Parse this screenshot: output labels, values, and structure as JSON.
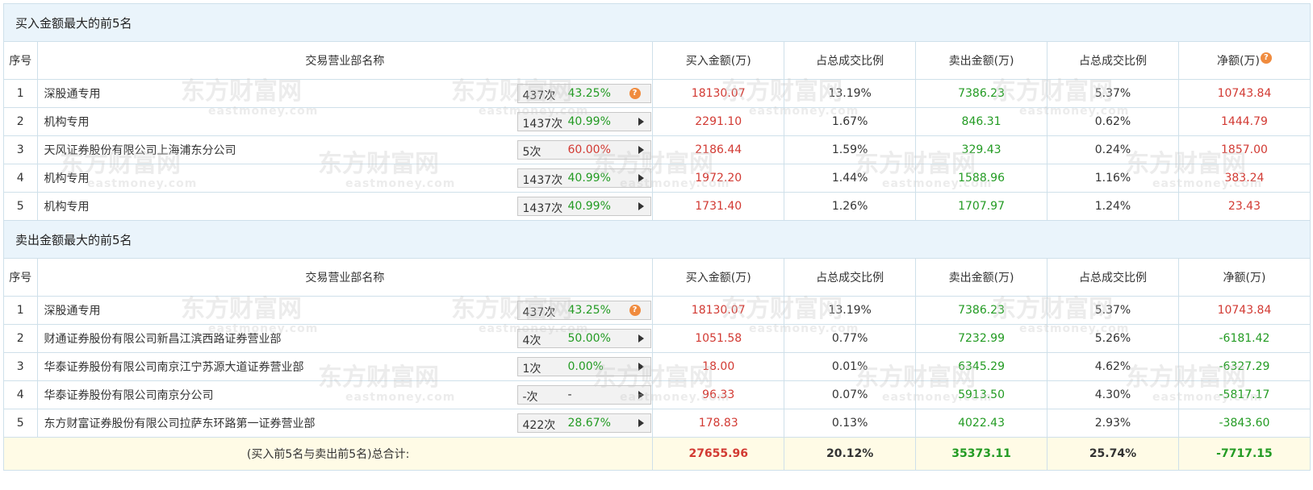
{
  "colors": {
    "red": "#d23a33",
    "green": "#239b23",
    "section_bg": "#eaf4fb",
    "total_bg": "#fffbe6"
  },
  "watermark": {
    "cn": "东方财富网",
    "en": "eastmoney.com"
  },
  "buy_section": {
    "title": "买入金额最大的前5名",
    "headers": [
      "序号",
      "交易营业部名称",
      "买入金额(万)",
      "占总成交比例",
      "卖出金额(万)",
      "占总成交比例",
      "净额(万)"
    ],
    "rows": [
      {
        "idx": "1",
        "name": "深股通专用",
        "count": "437次",
        "pct": "43.25%",
        "pct_color": "green",
        "icon": "question-icon",
        "buy": "18130.07",
        "buy_ratio": "13.19%",
        "sell": "7386.23",
        "sell_ratio": "5.37%",
        "net": "10743.84"
      },
      {
        "idx": "2",
        "name": "机构专用",
        "count": "1437次",
        "pct": "40.99%",
        "pct_color": "green",
        "icon": "arrow-right-icon",
        "buy": "2291.10",
        "buy_ratio": "1.67%",
        "sell": "846.31",
        "sell_ratio": "0.62%",
        "net": "1444.79"
      },
      {
        "idx": "3",
        "name": "天风证券股份有限公司上海浦东分公司",
        "count": "5次",
        "pct": "60.00%",
        "pct_color": "red",
        "icon": "arrow-right-icon",
        "buy": "2186.44",
        "buy_ratio": "1.59%",
        "sell": "329.43",
        "sell_ratio": "0.24%",
        "net": "1857.00"
      },
      {
        "idx": "4",
        "name": "机构专用",
        "count": "1437次",
        "pct": "40.99%",
        "pct_color": "green",
        "icon": "arrow-right-icon",
        "buy": "1972.20",
        "buy_ratio": "1.44%",
        "sell": "1588.96",
        "sell_ratio": "1.16%",
        "net": "383.24"
      },
      {
        "idx": "5",
        "name": "机构专用",
        "count": "1437次",
        "pct": "40.99%",
        "pct_color": "green",
        "icon": "arrow-right-icon",
        "buy": "1731.40",
        "buy_ratio": "1.26%",
        "sell": "1707.97",
        "sell_ratio": "1.24%",
        "net": "23.43"
      }
    ]
  },
  "sell_section": {
    "title": "卖出金额最大的前5名",
    "headers": [
      "序号",
      "交易营业部名称",
      "买入金额(万)",
      "占总成交比例",
      "卖出金额(万)",
      "占总成交比例",
      "净额(万)"
    ],
    "rows": [
      {
        "idx": "1",
        "name": "深股通专用",
        "count": "437次",
        "pct": "43.25%",
        "pct_color": "green",
        "icon": "question-icon",
        "buy": "18130.07",
        "buy_ratio": "13.19%",
        "sell": "7386.23",
        "sell_ratio": "5.37%",
        "net": "10743.84"
      },
      {
        "idx": "2",
        "name": "财通证券股份有限公司新昌江滨西路证券营业部",
        "count": "4次",
        "pct": "50.00%",
        "pct_color": "green",
        "icon": "arrow-right-icon",
        "buy": "1051.58",
        "buy_ratio": "0.77%",
        "sell": "7232.99",
        "sell_ratio": "5.26%",
        "net": "-6181.42"
      },
      {
        "idx": "3",
        "name": "华泰证券股份有限公司南京江宁苏源大道证券营业部",
        "count": "1次",
        "pct": "0.00%",
        "pct_color": "green",
        "icon": "arrow-right-icon",
        "buy": "18.00",
        "buy_ratio": "0.01%",
        "sell": "6345.29",
        "sell_ratio": "4.62%",
        "net": "-6327.29"
      },
      {
        "idx": "4",
        "name": "华泰证券股份有限公司南京分公司",
        "count": "-次",
        "pct": "-",
        "pct_color": "normal",
        "icon": "arrow-right-icon",
        "buy": "96.33",
        "buy_ratio": "0.07%",
        "sell": "5913.50",
        "sell_ratio": "4.30%",
        "net": "-5817.17"
      },
      {
        "idx": "5",
        "name": "东方财富证券股份有限公司拉萨东环路第一证券营业部",
        "count": "422次",
        "pct": "28.67%",
        "pct_color": "green",
        "icon": "arrow-right-icon",
        "buy": "178.83",
        "buy_ratio": "0.13%",
        "sell": "4022.43",
        "sell_ratio": "2.93%",
        "net": "-3843.60"
      }
    ]
  },
  "total": {
    "label": "(买入前5名与卖出前5名)总合计:",
    "buy": "27655.96",
    "buy_ratio": "20.12%",
    "sell": "35373.11",
    "sell_ratio": "25.74%",
    "net": "-7717.15"
  }
}
